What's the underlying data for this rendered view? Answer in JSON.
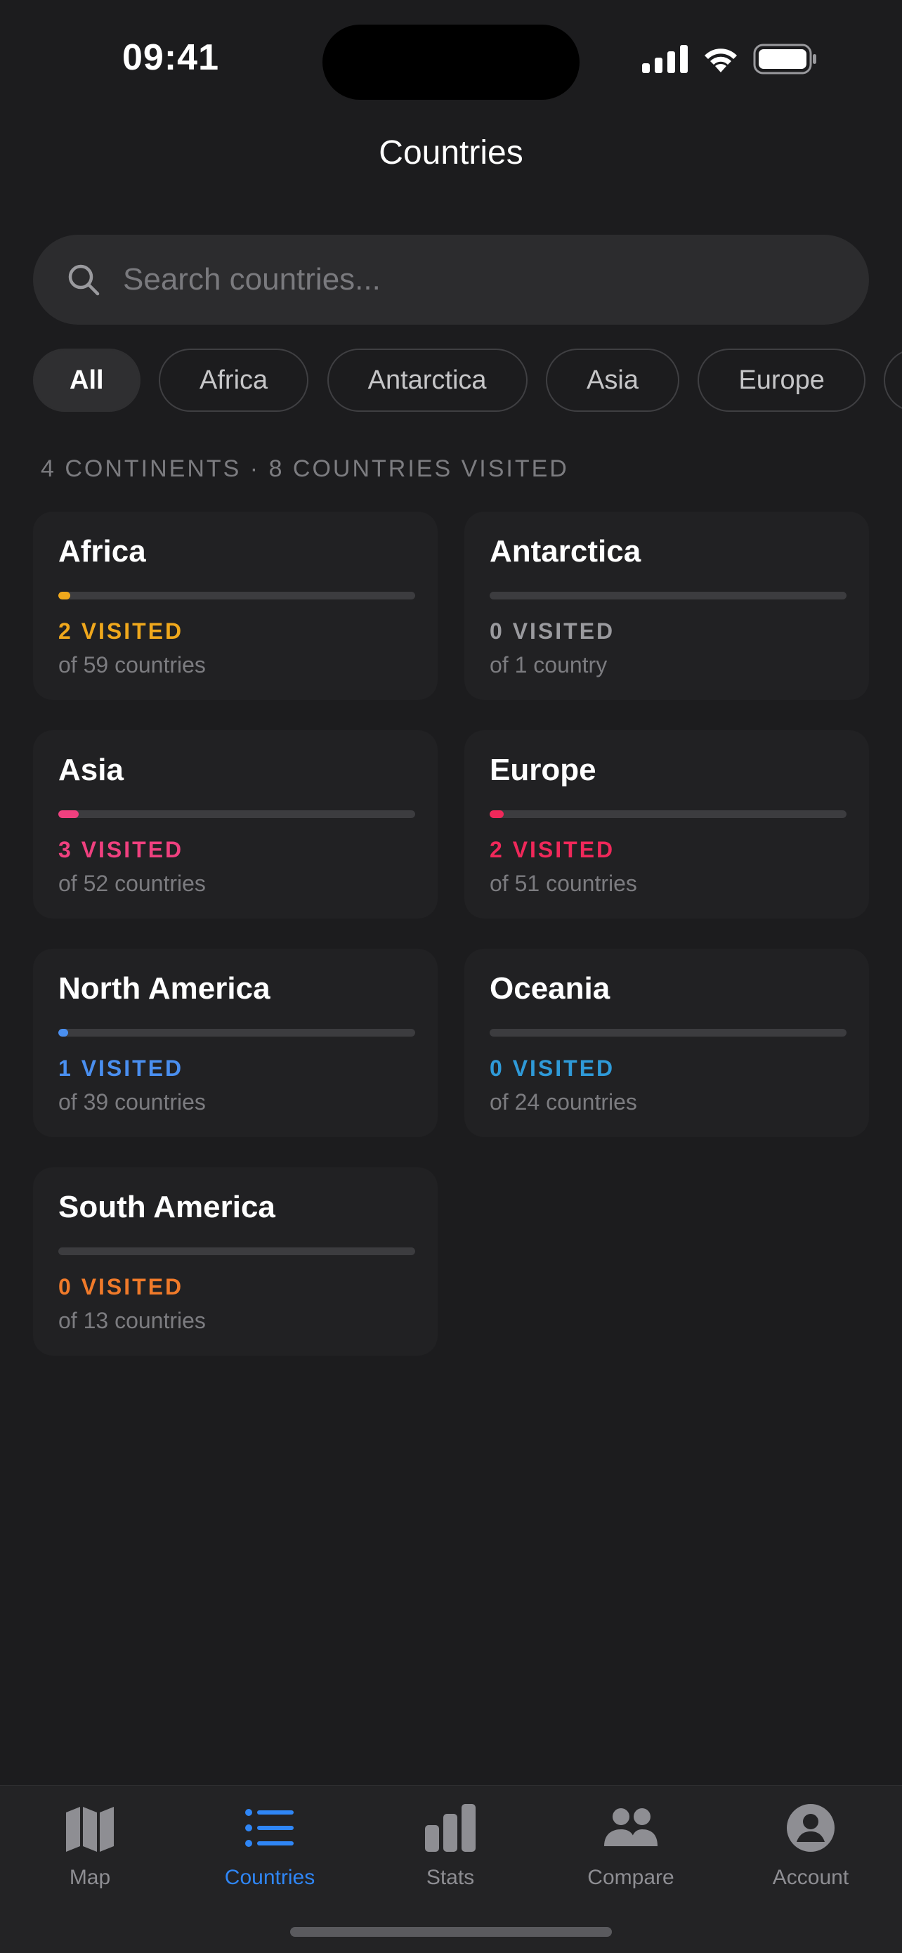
{
  "status_bar": {
    "time": "09:41"
  },
  "header": {
    "title": "Countries"
  },
  "search": {
    "placeholder": "Search countries...",
    "value": ""
  },
  "filters": [
    {
      "label": "All",
      "active": true
    },
    {
      "label": "Africa",
      "active": false
    },
    {
      "label": "Antarctica",
      "active": false
    },
    {
      "label": "Asia",
      "active": false
    },
    {
      "label": "Europe",
      "active": false
    },
    {
      "label": "",
      "active": false
    }
  ],
  "summary": "4 CONTINENTS · 8 COUNTRIES VISITED",
  "continents": [
    {
      "name": "Africa",
      "visited_label": "2 VISITED",
      "total_label": "of 59 countries",
      "progress": 0.034,
      "color": "#f0a81c"
    },
    {
      "name": "Antarctica",
      "visited_label": "0 VISITED",
      "total_label": "of 1 country",
      "progress": 0,
      "color": "#9a9a9e"
    },
    {
      "name": "Asia",
      "visited_label": "3 VISITED",
      "total_label": "of 52 countries",
      "progress": 0.058,
      "color": "#f0407f"
    },
    {
      "name": "Europe",
      "visited_label": "2 VISITED",
      "total_label": "of 51 countries",
      "progress": 0.039,
      "color": "#f0285a"
    },
    {
      "name": "North America",
      "visited_label": "1 VISITED",
      "total_label": "of 39 countries",
      "progress": 0.026,
      "color": "#4a8ff0"
    },
    {
      "name": "Oceania",
      "visited_label": "0 VISITED",
      "total_label": "of 24 countries",
      "progress": 0,
      "color": "#2f9ad8"
    },
    {
      "name": "South America",
      "visited_label": "0 VISITED",
      "total_label": "of 13 countries",
      "progress": 0,
      "color": "#f07a2a"
    }
  ],
  "tab_bar": {
    "tabs": [
      {
        "label": "Map",
        "icon": "map-icon",
        "active": false
      },
      {
        "label": "Countries",
        "icon": "list-icon",
        "active": true
      },
      {
        "label": "Stats",
        "icon": "bar-chart-icon",
        "active": false
      },
      {
        "label": "Compare",
        "icon": "people-icon",
        "active": false
      },
      {
        "label": "Account",
        "icon": "account-icon",
        "active": false
      }
    ]
  },
  "colors": {
    "accent": "#2f86f6",
    "background": "#1c1c1e",
    "card": "#212123"
  }
}
